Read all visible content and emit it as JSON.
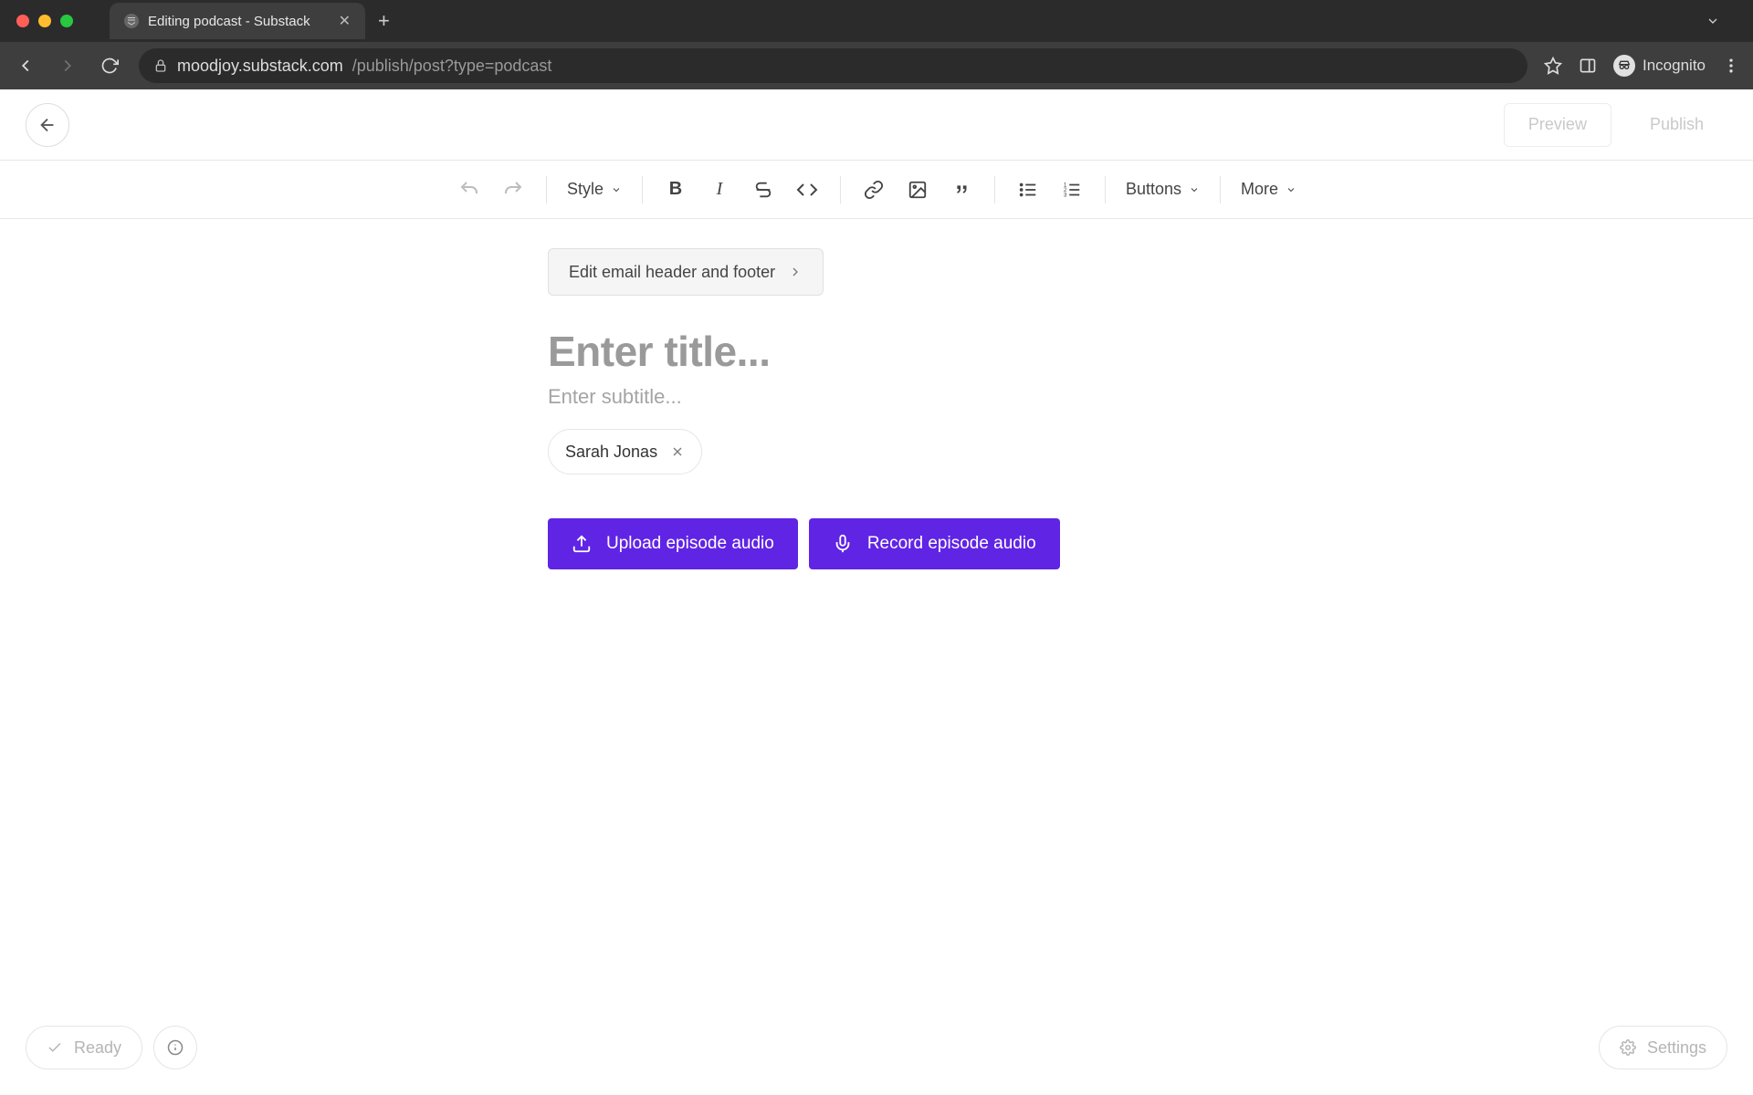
{
  "browser": {
    "tab_title": "Editing podcast - Substack",
    "url_host": "moodjoy.substack.com",
    "url_path": "/publish/post?type=podcast",
    "incognito_label": "Incognito"
  },
  "header": {
    "preview_label": "Preview",
    "publish_label": "Publish"
  },
  "toolbar": {
    "style_label": "Style",
    "buttons_label": "Buttons",
    "more_label": "More"
  },
  "editor": {
    "email_hf_label": "Edit email header and footer",
    "title_placeholder": "Enter title...",
    "subtitle_placeholder": "Enter subtitle...",
    "author_name": "Sarah Jonas",
    "upload_label": "Upload episode audio",
    "record_label": "Record episode audio"
  },
  "footer": {
    "ready_label": "Ready",
    "settings_label": "Settings"
  }
}
